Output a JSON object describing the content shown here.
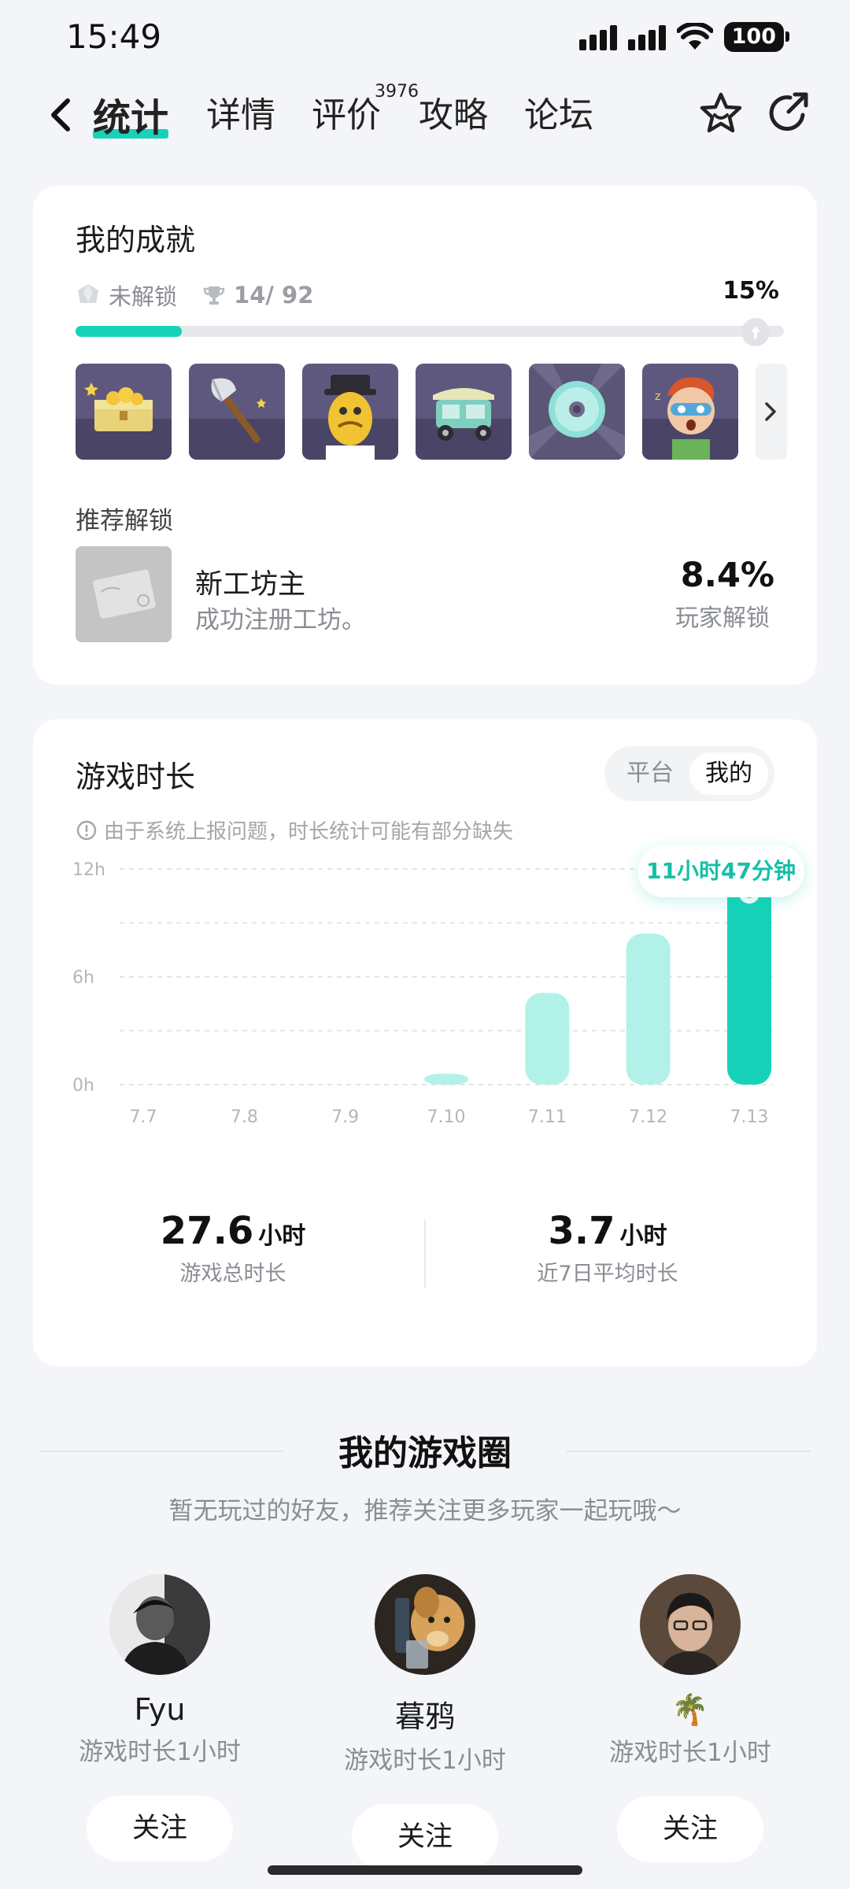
{
  "status_bar": {
    "time": "15:49",
    "battery": "100"
  },
  "nav": {
    "tabs": [
      {
        "label": "统计",
        "active": true
      },
      {
        "label": "详情",
        "active": false
      },
      {
        "label": "评价",
        "active": false
      },
      {
        "label": "攻略",
        "active": false
      },
      {
        "label": "论坛",
        "active": false
      }
    ],
    "review_count": "3976"
  },
  "achievements": {
    "title": "我的成就",
    "locked_label": "未解锁",
    "progress_text": "14/ 92",
    "percent_text": "15%",
    "progress": 0.15,
    "badges": [
      "treasure-chest-badge",
      "axe-badge",
      "character-badge",
      "tuk-tuk-badge",
      "disc-badge",
      "sleepy-face-badge"
    ],
    "recommend": {
      "label": "推荐解锁",
      "name": "新工坊主",
      "description": "成功注册工坊。",
      "percent": "8.4%",
      "percent_label": "玩家解锁"
    }
  },
  "playtime": {
    "title": "游戏时长",
    "toggle": {
      "platform": "平台",
      "mine": "我的"
    },
    "notice": "由于系统上报问题，时长统计可能有部分缺失",
    "tooltip": "11小时47分钟",
    "total": {
      "value": "27.6",
      "unit": "小时",
      "label": "游戏总时长"
    },
    "average": {
      "value": "3.7",
      "unit": "小时",
      "label": "近7日平均时长"
    }
  },
  "chart_data": {
    "type": "bar",
    "categories": [
      "7.7",
      "7.8",
      "7.9",
      "7.10",
      "7.11",
      "7.12",
      "7.13"
    ],
    "values": [
      0,
      0,
      0,
      0.6,
      5.1,
      8.4,
      11.78
    ],
    "yticks": [
      "0h",
      "6h",
      "12h"
    ],
    "ylim": [
      0,
      12
    ],
    "highlight_index": 6,
    "colors": {
      "bar": "#b2f1e8",
      "highlight": "#18d1b9"
    },
    "grid": true
  },
  "game_circle": {
    "title": "我的游戏圈",
    "subtitle": "暂无玩过的好友，推荐关注更多玩家一起玩哦～",
    "friends": [
      {
        "name": "Fyu",
        "playtime": "游戏时长1小时",
        "follow": "关注"
      },
      {
        "name": "暮鸦",
        "playtime": "游戏时长1小时",
        "follow": "关注"
      },
      {
        "name": "🌴",
        "playtime": "游戏时长1小时",
        "follow": "关注"
      }
    ]
  }
}
